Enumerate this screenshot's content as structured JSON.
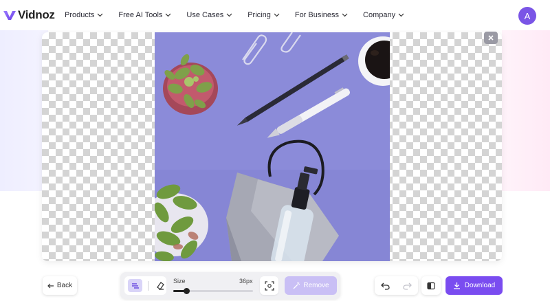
{
  "brand": {
    "name": "Vidnoz",
    "color": "#7a4cf0"
  },
  "nav": {
    "items": [
      {
        "label": "Products"
      },
      {
        "label": "Free AI Tools"
      },
      {
        "label": "Use Cases"
      },
      {
        "label": "Pricing"
      },
      {
        "label": "For Business"
      },
      {
        "label": "Company"
      }
    ]
  },
  "user": {
    "avatar_initial": "A"
  },
  "editor": {
    "image_icon": "product-photo-image",
    "close_icon": "close-icon"
  },
  "toolbar": {
    "back_label": "Back",
    "size_label": "Size",
    "size_value": "36px",
    "size_fraction": 0.16,
    "remove_label": "Remove",
    "download_label": "Download"
  }
}
